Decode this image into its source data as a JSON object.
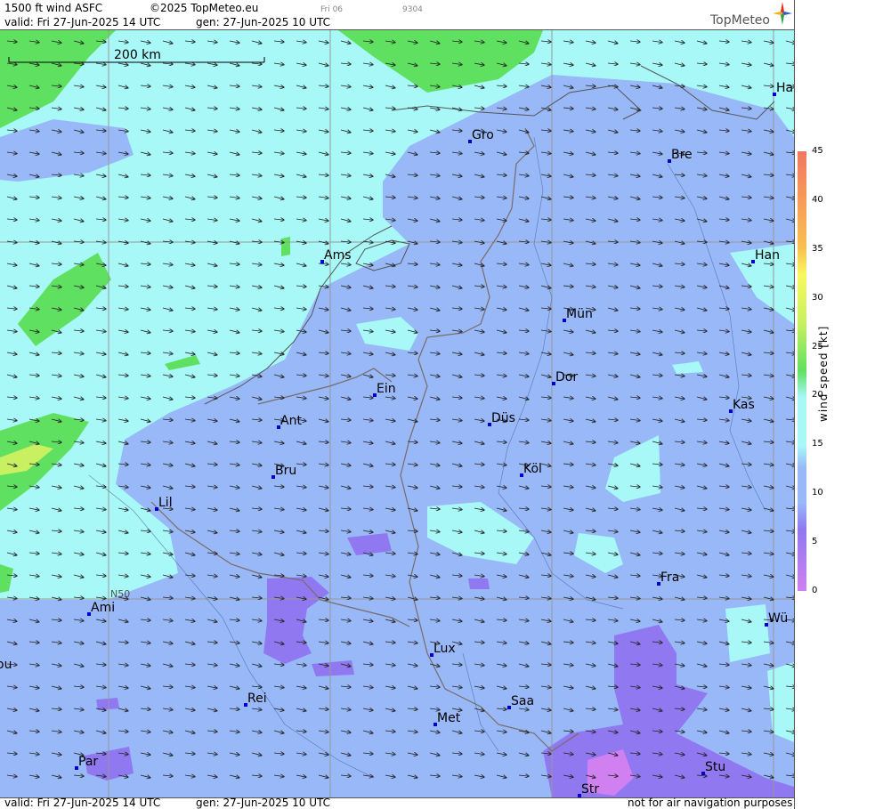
{
  "header": {
    "product": "1500 ft wind ASFC",
    "copyright": "©2025 TopMeteo.eu",
    "tag1": "Fri 06",
    "tag2": "9304",
    "valid": "valid:  Fri  27-Jun-2025  14 UTC",
    "gen": "gen:  27-Jun-2025 10 UTC",
    "logo": "TopMeteo"
  },
  "map": {
    "scale_label": "200 km",
    "lat_label": "N50",
    "cities": [
      {
        "name": "Gro"
      },
      {
        "name": "Bre"
      },
      {
        "name": "Ha"
      },
      {
        "name": "Ams"
      },
      {
        "name": "Han"
      },
      {
        "name": "Mün"
      },
      {
        "name": "Dor"
      },
      {
        "name": "Ein"
      },
      {
        "name": "Kas"
      },
      {
        "name": "Ant"
      },
      {
        "name": "Düs"
      },
      {
        "name": "Bru"
      },
      {
        "name": "Köl"
      },
      {
        "name": "Lil"
      },
      {
        "name": "Fra"
      },
      {
        "name": "Ami"
      },
      {
        "name": "Wü"
      },
      {
        "name": "ou"
      },
      {
        "name": "Lux"
      },
      {
        "name": "Rei"
      },
      {
        "name": "Saa"
      },
      {
        "name": "Met"
      },
      {
        "name": "Par"
      },
      {
        "name": "Stu"
      },
      {
        "name": "Str"
      }
    ]
  },
  "legend": {
    "title": "wind  speed  [kt]",
    "ticks": [
      "45",
      "40",
      "35",
      "30",
      "25",
      "20",
      "15",
      "10",
      "5",
      "0"
    ],
    "colors": [
      "#f07860",
      "#f8a050",
      "#f8d040",
      "#f8f860",
      "#c8f060",
      "#60e060",
      "#a8f8f8",
      "#98b8f8",
      "#9078f0",
      "#d080f0"
    ]
  },
  "footer": {
    "valid": "valid:  Fri  27-Jun-2025  14 UTC",
    "gen": "gen:  27-Jun-2025 10 UTC",
    "note": "not for air navigation purposes"
  }
}
